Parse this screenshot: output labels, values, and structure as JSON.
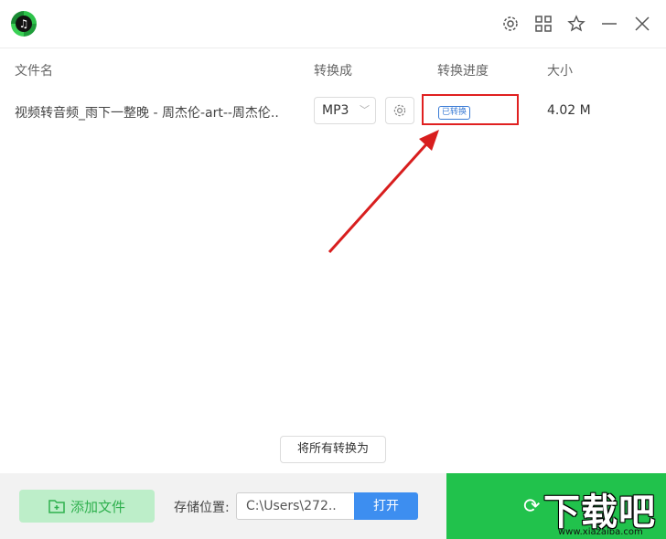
{
  "header": {
    "icons": [
      "settings-icon",
      "grid-icon",
      "star-icon",
      "minimize-icon",
      "close-icon"
    ]
  },
  "table": {
    "columns": {
      "name": "文件名",
      "format": "转换成",
      "progress": "转换进度",
      "size": "大小"
    },
    "rows": [
      {
        "name": "视频转音频_雨下一整晚 - 周杰伦-art--周杰伦..",
        "format": "MP3",
        "status": "已转换",
        "size": "4.02 M"
      }
    ]
  },
  "convert_all_label": "将所有转换为",
  "footer": {
    "add_label": "添加文件",
    "save_label": "存储位置:",
    "path_value": "C:\\Users\\272..",
    "open_label": "打开"
  },
  "watermark": {
    "big": "下载吧",
    "small": "www.xiazaiba.com"
  },
  "colors": {
    "accent_green": "#21c24c",
    "open_blue": "#3d8ef0",
    "highlight_red": "#e02020"
  }
}
